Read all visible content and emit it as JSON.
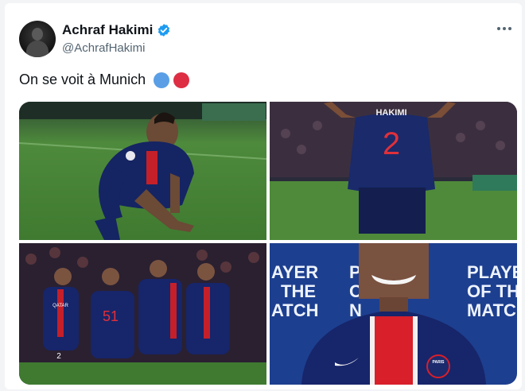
{
  "tweet": {
    "author_name": "Achraf Hakimi",
    "author_handle": "@AchrafHakimi",
    "text": "On se voit à Munich",
    "emoji_colors": [
      "#5a9fe6",
      "#dd2e44"
    ]
  },
  "photos": {
    "photo2_shirt_name": "HAKIMI",
    "photo2_shirt_number": "2",
    "photo3_shirt_numbers": [
      "2",
      "51"
    ],
    "photo3_sponsor": "QATAR",
    "photo4_backdrop_left": [
      "AYER",
      "THE",
      "ATCH"
    ],
    "photo4_backdrop_right_line1": "PLAYER",
    "photo4_backdrop_right_line2": "OF THE",
    "photo4_backdrop_right_line3": "MATCH",
    "photo4_backdrop_center": [
      "P",
      "O",
      "N"
    ],
    "photo4_badge": "PARIS"
  },
  "colors": {
    "psg_navy": "#15205c",
    "psg_red": "#d81f2a",
    "pitch_green": "#4f8a3a",
    "backdrop_blue": "#1d3f8f"
  }
}
